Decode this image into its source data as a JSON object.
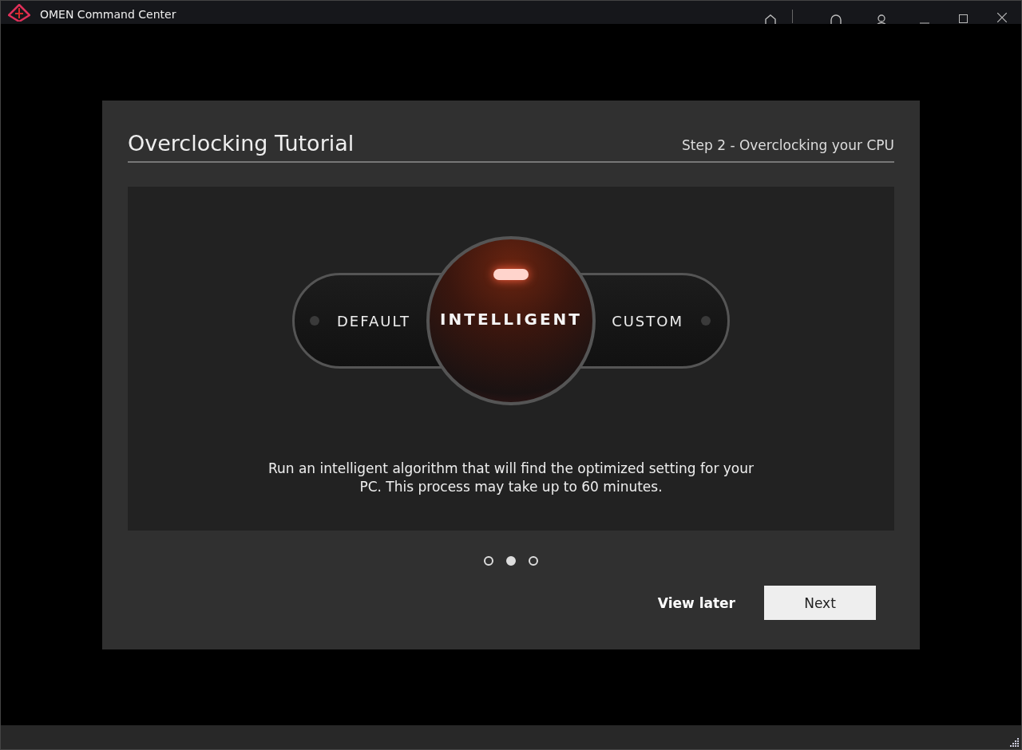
{
  "window": {
    "title": "OMEN Command Center"
  },
  "dialog": {
    "title": "Overclocking Tutorial",
    "step": "Step 2 - Overclocking your CPU",
    "modes": [
      {
        "label": "DEFAULT",
        "selected": false
      },
      {
        "label": "INTELLIGENT",
        "selected": true
      },
      {
        "label": "CUSTOM",
        "selected": false
      }
    ],
    "description": "Run an intelligent algorithm that will find the optimized setting for your PC. This process may take up to 60 minutes.",
    "pages": [
      {
        "selected": false
      },
      {
        "selected": true
      },
      {
        "selected": false
      }
    ],
    "buttons": [
      {
        "label": "View later",
        "kind": "text"
      },
      {
        "label": "Next",
        "kind": "primary"
      }
    ]
  }
}
